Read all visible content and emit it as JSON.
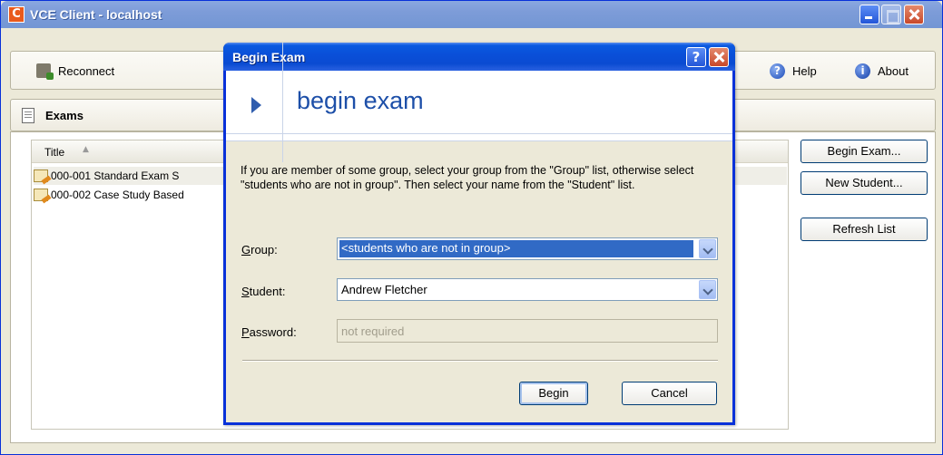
{
  "window": {
    "app_icon_letter": "C",
    "title": "VCE Client - localhost"
  },
  "toolbar": {
    "reconnect_label": "Reconnect",
    "help_label": "Help",
    "about_label": "About"
  },
  "section": {
    "title": "Exams"
  },
  "list": {
    "column_title": "Title",
    "rows": [
      {
        "text": "000-001 Standard Exam S"
      },
      {
        "text": "000-002 Case Study Based"
      }
    ]
  },
  "side_buttons": {
    "begin_exam": "Begin Exam...",
    "new_student": "New Student...",
    "refresh_list": "Refresh List"
  },
  "dialog": {
    "title": "Begin Exam",
    "help_glyph": "?",
    "banner_title": "begin exam",
    "instructions": "If you are member of some group, select your group from the \"Group\" list, otherwise select \"students who are not in group\". Then select your name from the \"Student\" list.",
    "group_label_access": "G",
    "group_label_rest": "roup:",
    "group_value": "<students who are not in group>",
    "student_label_access": "S",
    "student_label_rest": "tudent:",
    "student_value": "Andrew Fletcher",
    "password_label_access": "P",
    "password_label_rest": "assword:",
    "password_placeholder": "not required",
    "begin_button": "Begin",
    "cancel_button": "Cancel"
  },
  "colors": {
    "titlebar_blue": "#0a4fd8",
    "selection_blue": "#316ac5",
    "banner_text": "#1d4fa8",
    "window_bg": "#ece9d8"
  }
}
